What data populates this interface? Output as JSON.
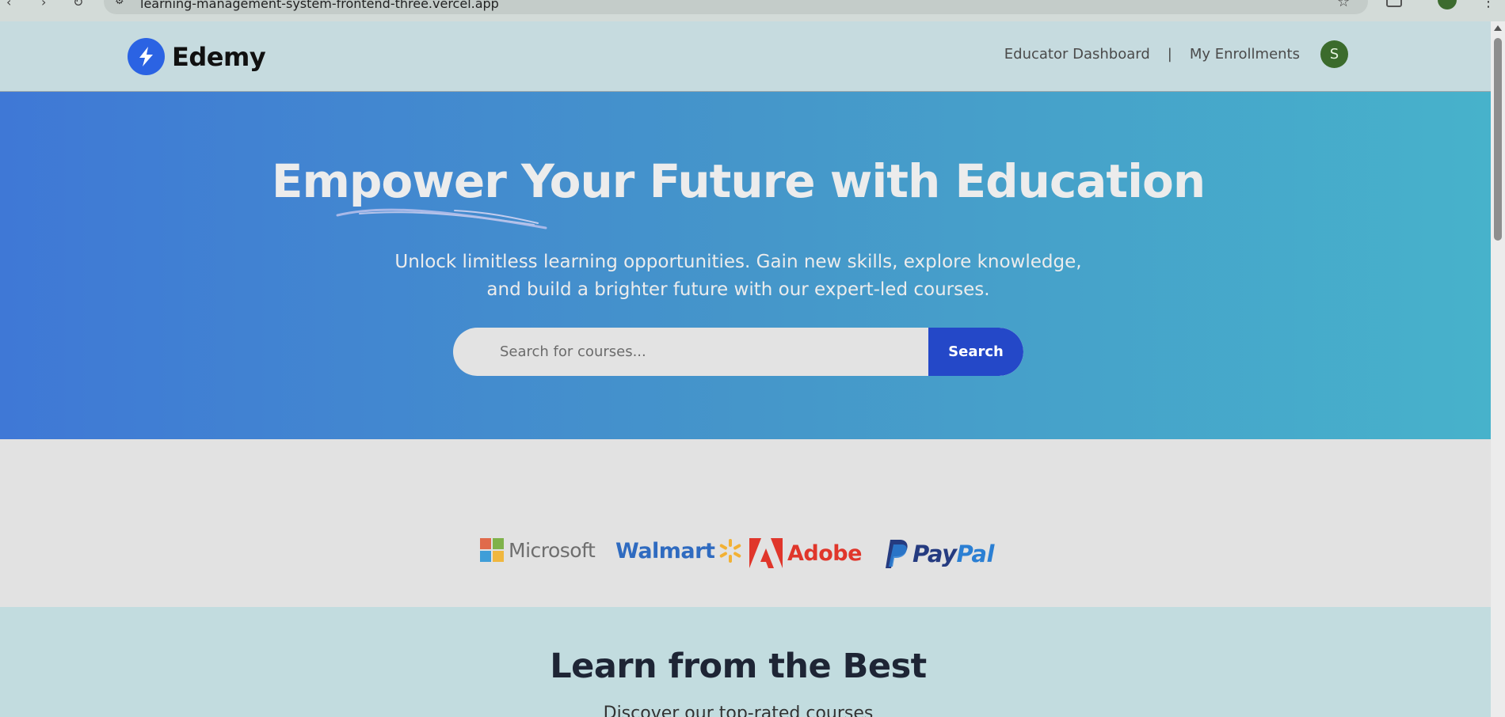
{
  "browser": {
    "url": "learning-management-system-frontend-three.vercel.app",
    "nav_icons": [
      "back-arrow-icon",
      "forward-arrow-icon",
      "reload-icon"
    ]
  },
  "header": {
    "logo_text": "Edemy",
    "nav": {
      "educator_dashboard": "Educator Dashboard",
      "separator": "|",
      "my_enrollments": "My Enrollments"
    },
    "avatar_initial": "S"
  },
  "hero": {
    "title": "Empower Your Future with Education",
    "subtitle_line1": "Unlock limitless learning opportunities. Gain new skills, explore knowledge,",
    "subtitle_line2": "and build a brighter future with our expert-led courses.",
    "search": {
      "placeholder": "Search for courses...",
      "button_label": "Search"
    }
  },
  "companies": {
    "microsoft": "Microsoft",
    "walmart": "Walmart",
    "adobe": "Adobe",
    "paypal_part1": "Pay",
    "paypal_part2": "Pal"
  },
  "learn": {
    "title": "Learn from the Best",
    "subtitle": "Discover our top-rated courses"
  },
  "colors": {
    "brand_blue": "#2b63e3",
    "search_button": "#2448c8",
    "avatar_green": "#3b6b2c",
    "hero_gradient_start": "#3f78d6",
    "hero_gradient_end": "#47b2cb"
  }
}
